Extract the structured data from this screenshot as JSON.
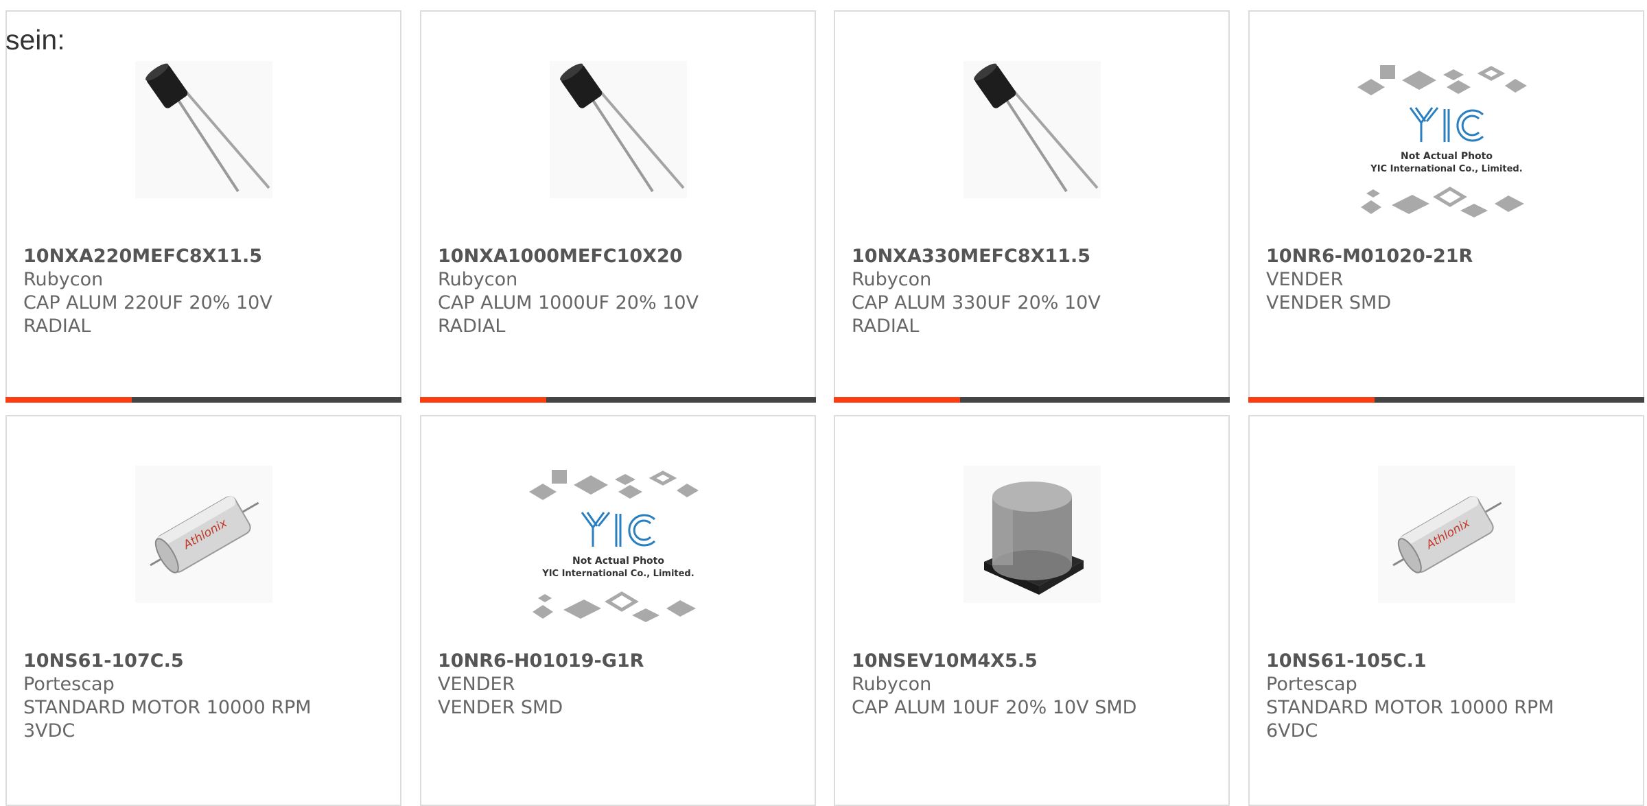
{
  "intro_text": "sein:",
  "colors": {
    "accent": "#ff3c10",
    "bar": "#444444",
    "border": "#dcdcdc"
  },
  "products": [
    {
      "part": "10NXA220MEFC8X11.5",
      "maker": "Rubycon",
      "desc1": "CAP ALUM 220UF 20% 10V",
      "desc2": "RADIAL",
      "image": "radial-capacitor-image"
    },
    {
      "part": "10NXA1000MEFC10X20",
      "maker": "Rubycon",
      "desc1": "CAP ALUM 1000UF 20% 10V",
      "desc2": "RADIAL",
      "image": "radial-capacitor-image"
    },
    {
      "part": "10NXA330MEFC8X11.5",
      "maker": "Rubycon",
      "desc1": "CAP ALUM 330UF 20% 10V",
      "desc2": "RADIAL",
      "image": "radial-capacitor-image"
    },
    {
      "part": "10NR6-M01020-21R",
      "maker": "VENDER",
      "desc1": "VENDER SMD",
      "desc2": "",
      "image": "placeholder-chips-image",
      "placeholder": {
        "logo": "YIC",
        "line1": "Not Actual Photo",
        "line2": "YIC International Co., Limited."
      }
    },
    {
      "part": "10NS61-107C.5",
      "maker": "Portescap",
      "desc1": "STANDARD MOTOR 10000 RPM",
      "desc2": "3VDC",
      "image": "dc-motor-image",
      "brand": "Athlonix"
    },
    {
      "part": "10NR6-H01019-G1R",
      "maker": "VENDER",
      "desc1": "VENDER SMD",
      "desc2": "",
      "image": "placeholder-chips-image",
      "placeholder": {
        "logo": "YIC",
        "line1": "Not Actual Photo",
        "line2": "YIC International Co., Limited."
      }
    },
    {
      "part": "10NSEV10M4X5.5",
      "maker": "Rubycon",
      "desc1": "CAP ALUM 10UF 20% 10V SMD",
      "desc2": "",
      "image": "smd-capacitor-image"
    },
    {
      "part": "10NS61-105C.1",
      "maker": "Portescap",
      "desc1": "STANDARD MOTOR 10000 RPM",
      "desc2": "6VDC",
      "image": "dc-motor-image",
      "brand": "Athlonix"
    }
  ]
}
